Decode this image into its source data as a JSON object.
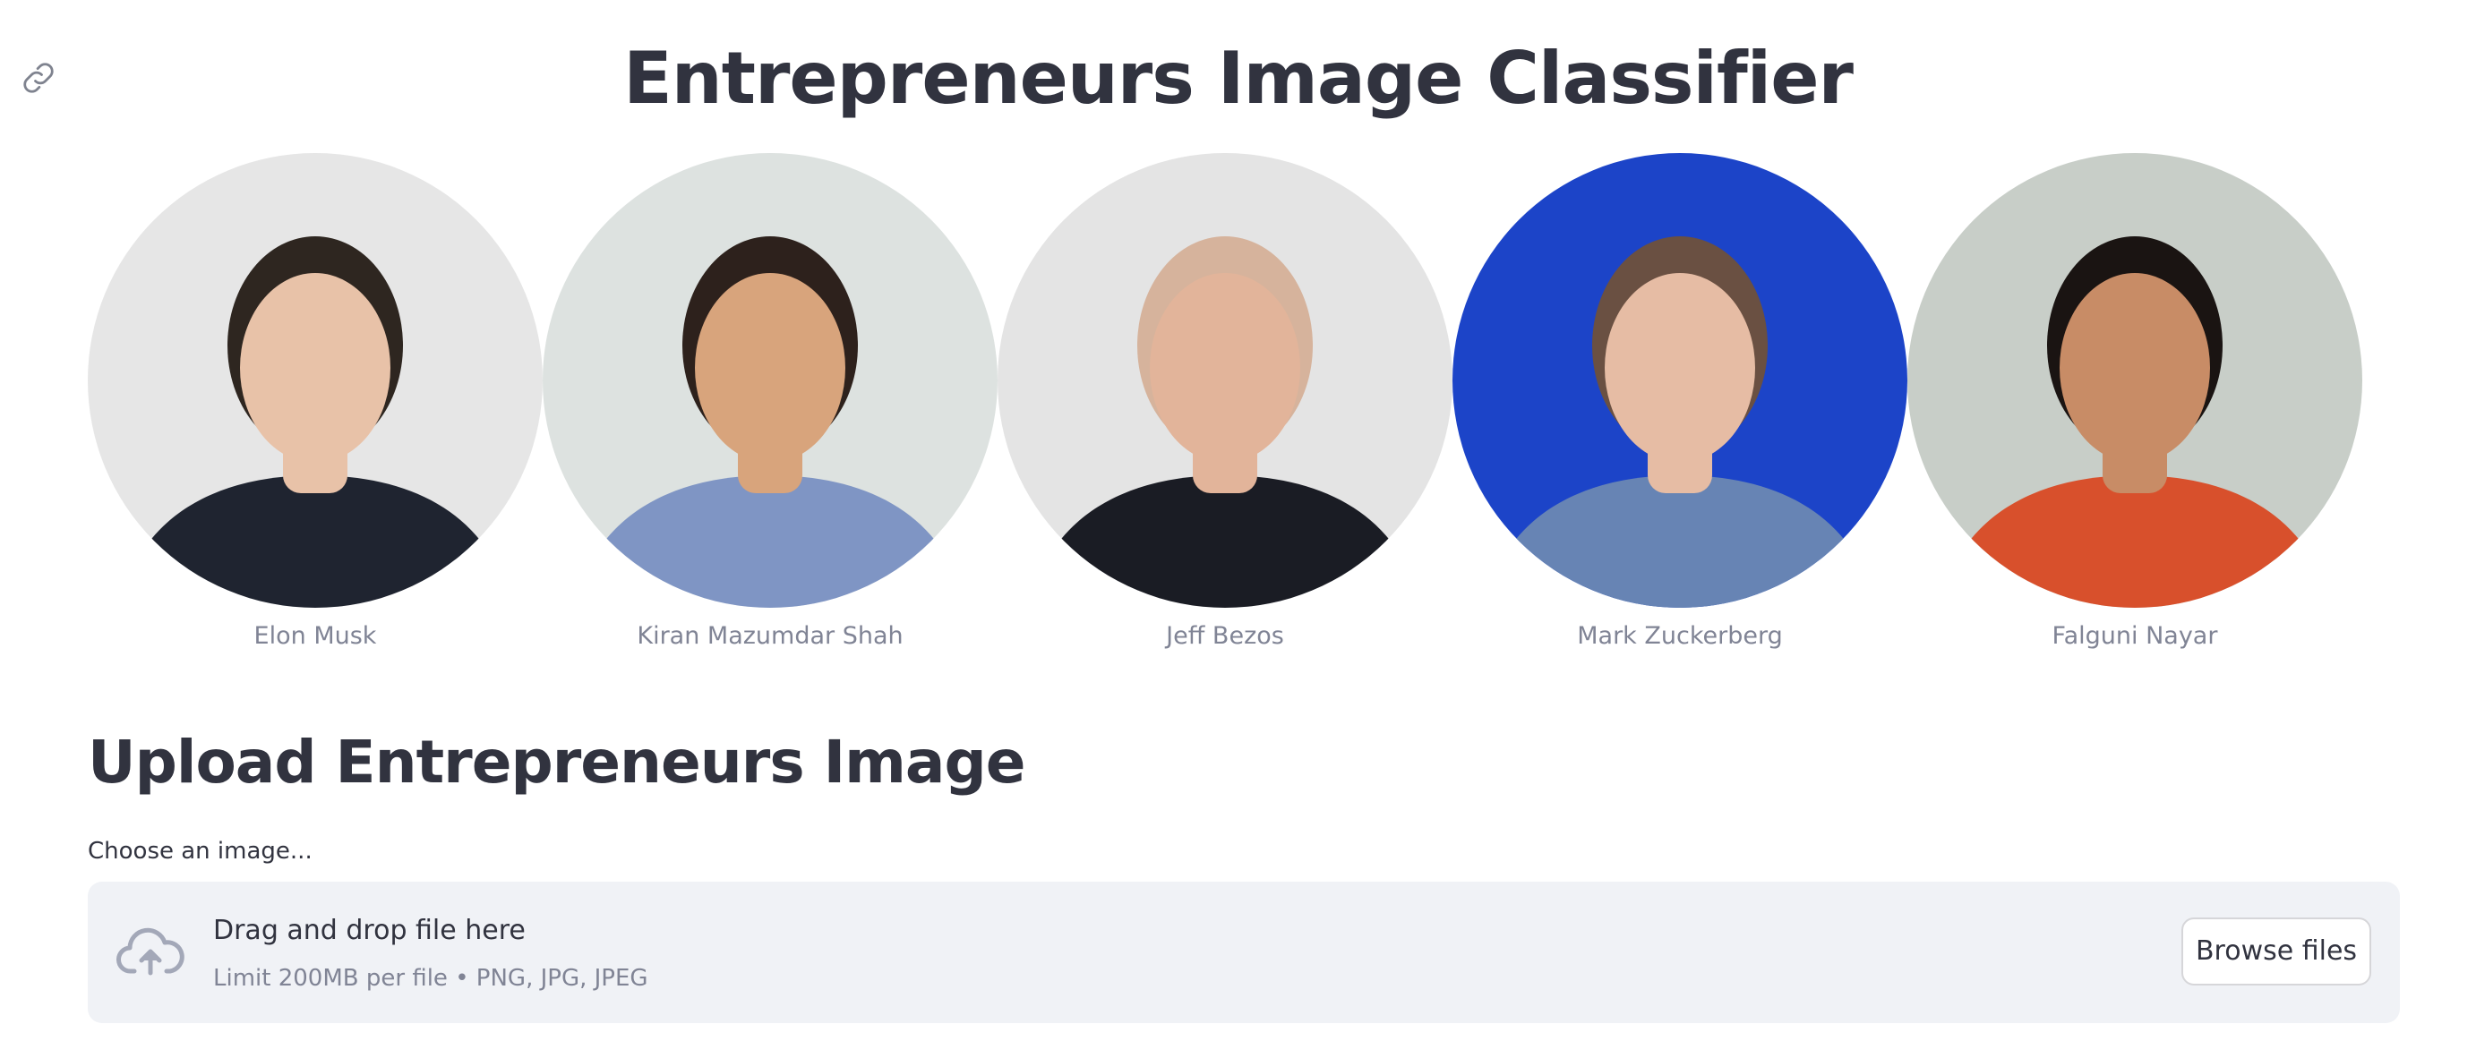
{
  "header": {
    "title": "Entrepreneurs Image Classifier",
    "anchor_icon": "link-icon"
  },
  "gallery": {
    "people": [
      {
        "name": "Elon Musk",
        "background_color": "#e6e6e6",
        "hair_color": "#2e2620",
        "skin_color": "#e8c2a8",
        "clothing_color": "#1f2430"
      },
      {
        "name": "Kiran Mazumdar Shah",
        "background_color": "#dde2e0",
        "hair_color": "#2d211c",
        "skin_color": "#d8a47c",
        "clothing_color": "#7f95c4"
      },
      {
        "name": "Jeff Bezos",
        "background_color": "#e4e4e4",
        "hair_color": "#d6b39c",
        "skin_color": "#e2b49a",
        "clothing_color": "#1a1c24"
      },
      {
        "name": "Mark Zuckerberg",
        "background_color": "#1c44c8",
        "hair_color": "#6a5042",
        "skin_color": "#e6bca4",
        "clothing_color": "#6784b4"
      },
      {
        "name": "Falguni Nayar",
        "background_color": "#c8cec8",
        "hair_color": "#1a1412",
        "skin_color": "#c88c66",
        "clothing_color": "#d8502c"
      }
    ]
  },
  "upload": {
    "heading": "Upload Entrepreneurs Image",
    "label": "Choose an image...",
    "drop_title": "Drag and drop file here",
    "drop_limit": "Limit 200MB per file • PNG, JPG, JPEG",
    "browse_label": "Browse files",
    "upload_icon": "cloud-upload-icon"
  },
  "colors": {
    "text_primary": "#31333f",
    "text_secondary": "#808495",
    "dropzone_background": "#f0f2f6",
    "icon_gray": "#a3a8b8"
  }
}
